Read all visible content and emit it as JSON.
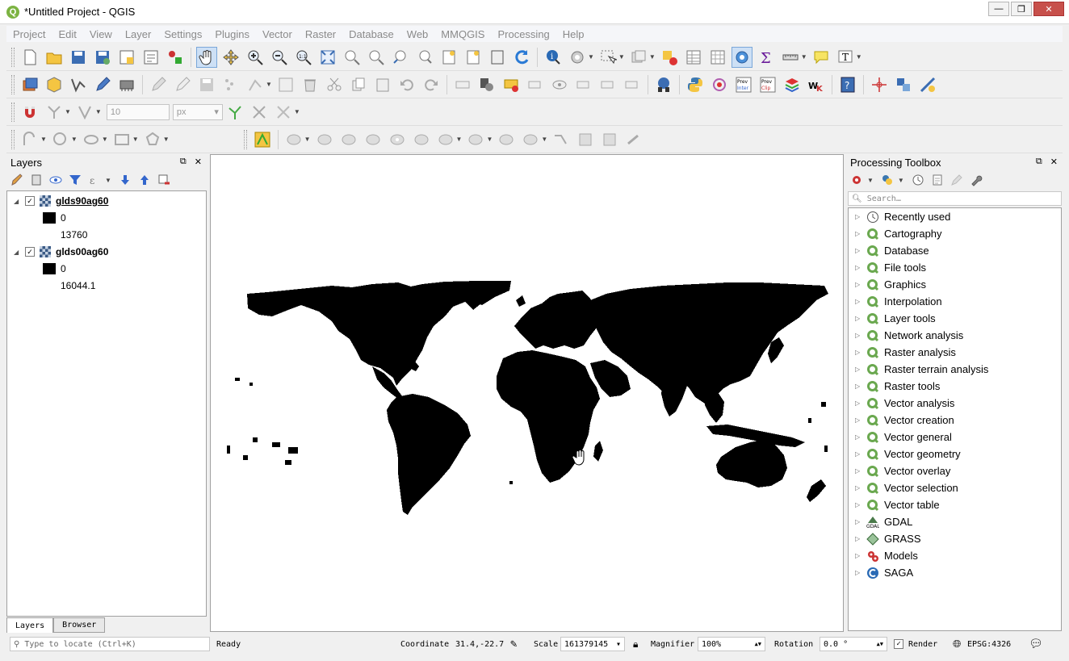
{
  "window": {
    "title": "*Untitled Project - QGIS",
    "logo": "Q"
  },
  "menu": [
    "Project",
    "Edit",
    "View",
    "Layer",
    "Settings",
    "Plugins",
    "Vector",
    "Raster",
    "Database",
    "Web",
    "MMQGIS",
    "Processing",
    "Help"
  ],
  "snapping": {
    "tolerance": "10",
    "unit": "px"
  },
  "layers_panel": {
    "title": "Layers",
    "layers": [
      {
        "name": "glds90ag60",
        "checked": true,
        "legend": [
          "0",
          "13760"
        ]
      },
      {
        "name": "glds00ag60",
        "checked": true,
        "legend": [
          "0",
          "16044.1"
        ]
      }
    ],
    "tabs": [
      "Layers",
      "Browser"
    ]
  },
  "toolbox": {
    "title": "Processing Toolbox",
    "search_placeholder": "Search…",
    "items": [
      {
        "label": "Recently used",
        "icon": "clock-icon"
      },
      {
        "label": "Cartography",
        "icon": "qgis-icon"
      },
      {
        "label": "Database",
        "icon": "qgis-icon"
      },
      {
        "label": "File tools",
        "icon": "qgis-icon"
      },
      {
        "label": "Graphics",
        "icon": "qgis-icon"
      },
      {
        "label": "Interpolation",
        "icon": "qgis-icon"
      },
      {
        "label": "Layer tools",
        "icon": "qgis-icon"
      },
      {
        "label": "Network analysis",
        "icon": "qgis-icon"
      },
      {
        "label": "Raster analysis",
        "icon": "qgis-icon"
      },
      {
        "label": "Raster terrain analysis",
        "icon": "qgis-icon"
      },
      {
        "label": "Raster tools",
        "icon": "qgis-icon"
      },
      {
        "label": "Vector analysis",
        "icon": "qgis-icon"
      },
      {
        "label": "Vector creation",
        "icon": "qgis-icon"
      },
      {
        "label": "Vector general",
        "icon": "qgis-icon"
      },
      {
        "label": "Vector geometry",
        "icon": "qgis-icon"
      },
      {
        "label": "Vector overlay",
        "icon": "qgis-icon"
      },
      {
        "label": "Vector selection",
        "icon": "qgis-icon"
      },
      {
        "label": "Vector table",
        "icon": "qgis-icon"
      },
      {
        "label": "GDAL",
        "icon": "gdal-icon"
      },
      {
        "label": "GRASS",
        "icon": "grass-icon"
      },
      {
        "label": "Models",
        "icon": "models-icon"
      },
      {
        "label": "SAGA",
        "icon": "saga-icon"
      }
    ]
  },
  "statusbar": {
    "locator_placeholder": "Type to locate (Ctrl+K)",
    "status": "Ready",
    "coordinate_label": "Coordinate",
    "coordinate": "31.4,-22.7",
    "scale_label": "Scale",
    "scale": "161379145",
    "magnifier_label": "Magnifier",
    "magnifier": "100%",
    "rotation_label": "Rotation",
    "rotation": "0.0 °",
    "render_label": "Render",
    "crs": "EPSG:4326"
  },
  "colors": {
    "accent": "#7cb342",
    "land": "#000000",
    "selection": "#cde0f5"
  }
}
